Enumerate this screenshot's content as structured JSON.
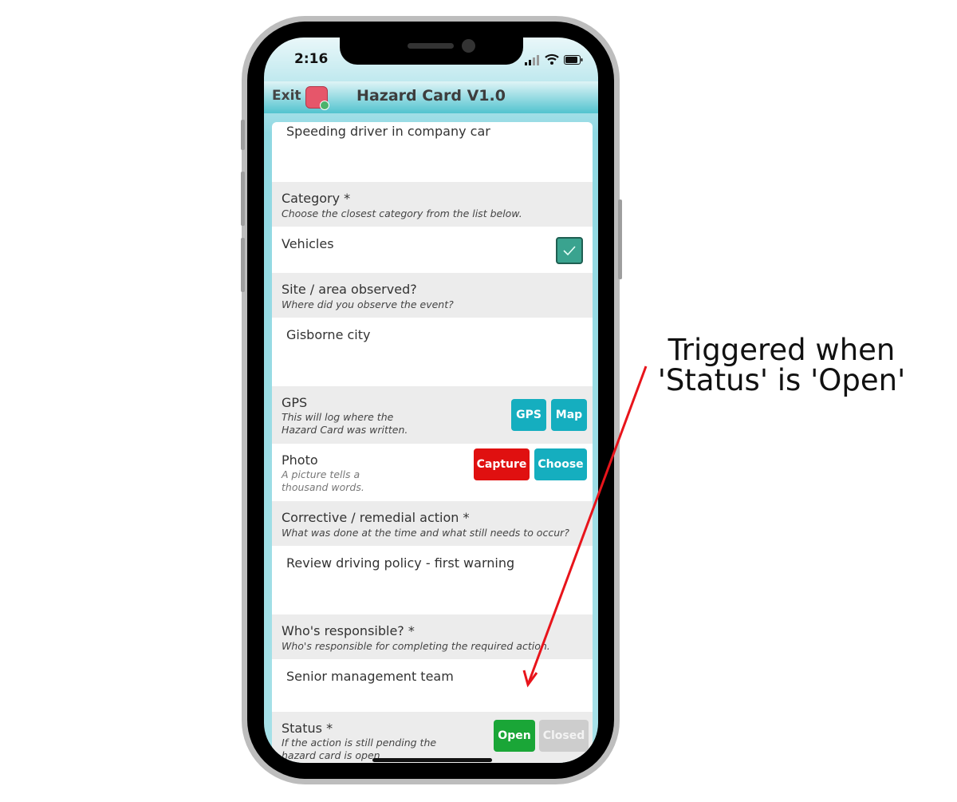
{
  "status_bar": {
    "time": "2:16"
  },
  "nav": {
    "exit_label": "Exit",
    "title": "Hazard Card V1.0"
  },
  "form": {
    "description_value": "Speeding driver in company car",
    "category": {
      "label": "Category *",
      "hint": "Choose the closest category from the list below.",
      "value": "Vehicles",
      "checked": true
    },
    "site": {
      "label": "Site / area observed?",
      "hint": "Where did you observe the event?",
      "value": "Gisborne city"
    },
    "gps": {
      "label": "GPS",
      "hint_line1": "This will log where the",
      "hint_line2": "Hazard Card was written.",
      "gps_button": "GPS",
      "map_button": "Map"
    },
    "photo": {
      "label": "Photo",
      "hint_line1": "A picture tells a",
      "hint_line2": "thousand words.",
      "capture_button": "Capture",
      "choose_button": "Choose"
    },
    "corrective": {
      "label": "Corrective / remedial action *",
      "hint": "What was done at the time and what still needs to occur?",
      "value": "Review driving policy - first warning"
    },
    "responsible": {
      "label": "Who's responsible? *",
      "hint": "Who's responsible for completing the required action.",
      "value": "Senior management team"
    },
    "status": {
      "label": "Status *",
      "hint_line1": "If the action is still pending the",
      "hint_line2": "hazard card is open",
      "open_button": "Open",
      "closed_button": "Closed",
      "selected": "Open"
    }
  },
  "annotation": {
    "line1": "Triggered when",
    "line2": "'Status' is 'Open'",
    "arrow_color": "#e8141b"
  },
  "colors": {
    "accent": "#15aebf",
    "capture": "#e01010",
    "open": "#1aa637",
    "closed_disabled": "#cdcdcd"
  }
}
